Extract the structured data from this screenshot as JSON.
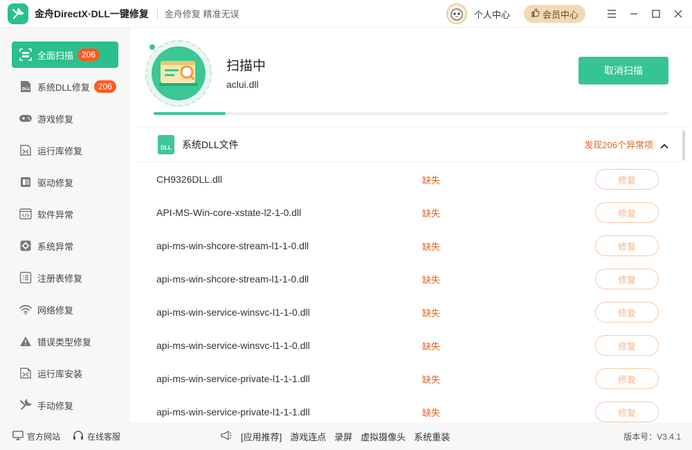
{
  "window": {
    "title": "金舟DirectX·DLL一键修复",
    "slogan": "金舟修复 精准无误",
    "personal_center": "个人中心",
    "vip_center": "会员中心"
  },
  "sidebar": {
    "items": [
      {
        "label": "全面扫描",
        "icon": "scan-icon",
        "badge": "206",
        "active": true
      },
      {
        "label": "系统DLL修复",
        "icon": "dll-icon",
        "badge": "206"
      },
      {
        "label": "游戏修复",
        "icon": "gamepad-icon"
      },
      {
        "label": "运行库修复",
        "icon": "vs-runtime-icon"
      },
      {
        "label": "驱动修复",
        "icon": "driver-icon"
      },
      {
        "label": "软件异常",
        "icon": "code-window-icon"
      },
      {
        "label": "系统异常",
        "icon": "gear-icon"
      },
      {
        "label": "注册表修复",
        "icon": "list-icon"
      },
      {
        "label": "网络修复",
        "icon": "wifi-icon"
      },
      {
        "label": "错误类型修复",
        "icon": "warning-icon"
      },
      {
        "label": "运行库安装",
        "icon": "runtime-install-icon"
      },
      {
        "label": "手动修复",
        "icon": "wrench-icon"
      }
    ]
  },
  "scan": {
    "title": "扫描中",
    "current_file": "aclui.dll",
    "cancel_label": "取消扫描",
    "progress": 0.14
  },
  "group": {
    "icon_text": "DLL",
    "title": "系统DLL文件",
    "found": "发现206个异常项"
  },
  "rows": [
    {
      "name": "CH9326DLL.dll",
      "status": "缺失",
      "action": "修复"
    },
    {
      "name": "API-MS-Win-core-xstate-l2-1-0.dll",
      "status": "缺失",
      "action": "修复"
    },
    {
      "name": "api-ms-win-shcore-stream-l1-1-0.dll",
      "status": "缺失",
      "action": "修复"
    },
    {
      "name": "api-ms-win-shcore-stream-l1-1-0.dll",
      "status": "缺失",
      "action": "修复"
    },
    {
      "name": "api-ms-win-service-winsvc-l1-1-0.dll",
      "status": "缺失",
      "action": "修复"
    },
    {
      "name": "api-ms-win-service-winsvc-l1-1-0.dll",
      "status": "缺失",
      "action": "修复"
    },
    {
      "name": "api-ms-win-service-private-l1-1-1.dll",
      "status": "缺失",
      "action": "修复"
    },
    {
      "name": "api-ms-win-service-private-l1-1-1.dll",
      "status": "缺失",
      "action": "修复"
    }
  ],
  "footer": {
    "official_site": "官方网站",
    "online_service": "在线客服",
    "recommend": "[应用推荐]",
    "links": [
      "游戏连点",
      "录屏",
      "虚拟摄像头",
      "系统重装"
    ],
    "version": "版本号：V3.4.1"
  },
  "colors": {
    "accent": "#2bbf8e",
    "warning": "#e2661e",
    "badge": "#ff5a1f"
  }
}
